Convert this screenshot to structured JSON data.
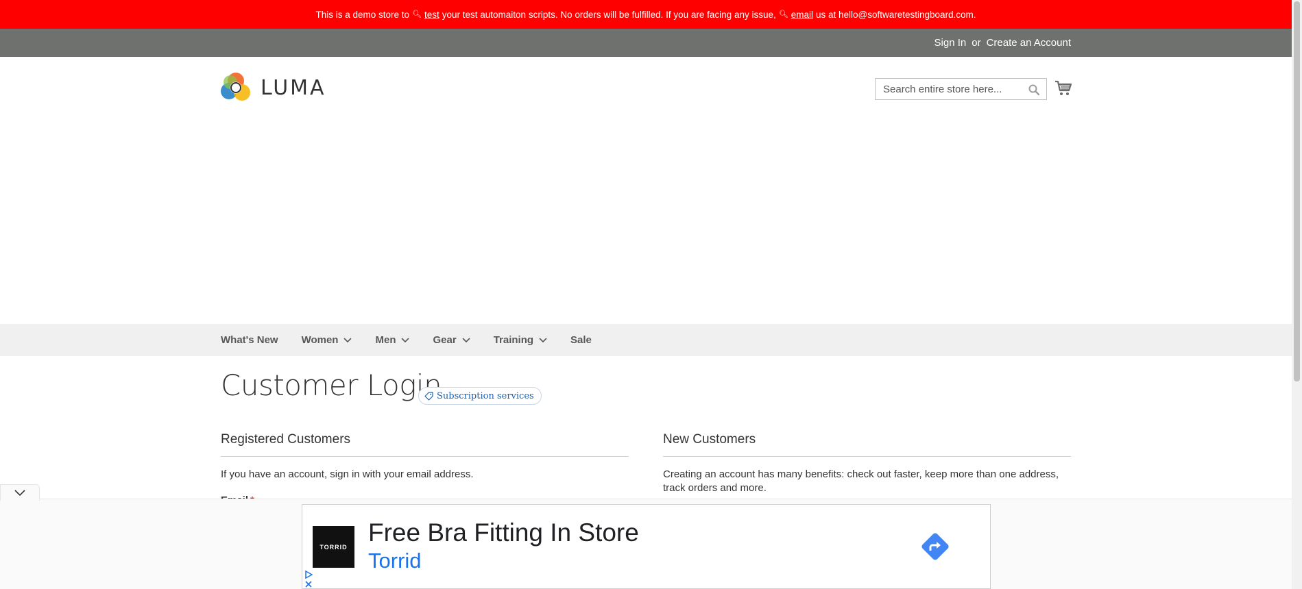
{
  "demo_notice": {
    "part1": "This is a demo store to",
    "link_test": "test",
    "part2": "your test automaiton scripts. No orders will be fulfilled. If you are facing any issue,",
    "link_email": "email",
    "part3": "us at hello@softwaretestingboard.com."
  },
  "header_links": {
    "sign_in": "Sign In",
    "or": "or",
    "create_account": "Create an Account"
  },
  "logo": {
    "text": "LUMA"
  },
  "search": {
    "placeholder": "Search entire store here..."
  },
  "nav": {
    "items": [
      {
        "label": "What's New",
        "has_dropdown": false
      },
      {
        "label": "Women",
        "has_dropdown": true
      },
      {
        "label": "Men",
        "has_dropdown": true
      },
      {
        "label": "Gear",
        "has_dropdown": true
      },
      {
        "label": "Training",
        "has_dropdown": true
      },
      {
        "label": "Sale",
        "has_dropdown": false
      }
    ]
  },
  "page": {
    "title": "Customer Login",
    "subscription_pill": "Subscription services"
  },
  "registered": {
    "title": "Registered Customers",
    "text": "If you have an account, sign in with your email address.",
    "email_label": "Email",
    "required_mark": "*"
  },
  "new_customers": {
    "title": "New Customers",
    "text": "Creating an account has many benefits: check out faster, keep more than one address, track orders and more."
  },
  "ad": {
    "brand": "TORRID",
    "headline": "Free Bra Fitting In Store",
    "advertiser": "Torrid"
  },
  "colors": {
    "demo_bar": "#ff0000",
    "top_strip": "#6e716e",
    "nav_bg": "#f0f0f0",
    "ad_link": "#1a73e8",
    "directions_button": "#4285f4"
  }
}
